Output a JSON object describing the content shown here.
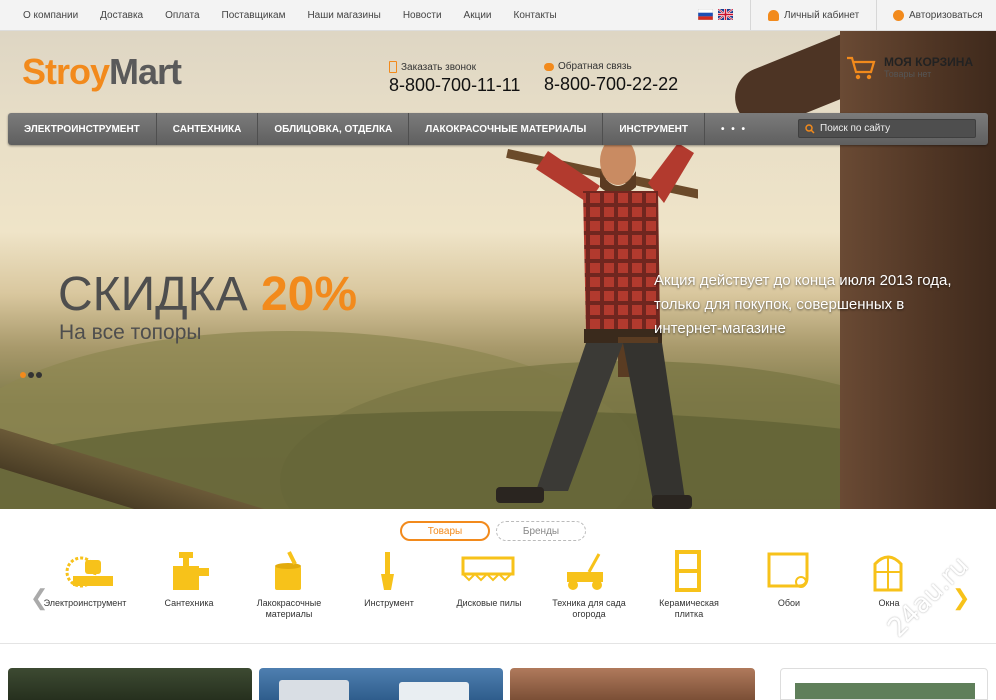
{
  "topnav": [
    "О компании",
    "Доставка",
    "Оплата",
    "Поставщикам",
    "Наши магазины",
    "Новости",
    "Акции",
    "Контакты"
  ],
  "account": {
    "cabinet": "Личный кабинет",
    "login": "Авторизоваться"
  },
  "logo": {
    "part1": "Stroy",
    "part2": "Mart"
  },
  "phones": [
    {
      "label": "Заказать звонок",
      "number": "8-800-700-11-11",
      "icon": "phone-icon"
    },
    {
      "label": "Обратная связь",
      "number": "8-800-700-22-22",
      "icon": "chat-icon"
    }
  ],
  "cart": {
    "title": "МОЯ КОРЗИНА",
    "subtitle": "Товары нет"
  },
  "menu": [
    "ЭЛЕКТРОИНСТРУМЕНТ",
    "САНТЕХНИКА",
    "ОБЛИЦОВКА, ОТДЕЛКА",
    "ЛАКОКРАСОЧНЫЕ МАТЕРИАЛЫ",
    "ИНСТРУМЕНТ",
    "• • •"
  ],
  "search": {
    "placeholder": "Поиск по сайту"
  },
  "promo": {
    "title": "СКИДКА",
    "percent": "20%",
    "subtitle": "На все топоры",
    "note": "Акция действует до конца июля 2013 года, только для покупок, совершенных в интернет-магазине"
  },
  "slider": {
    "active": 1,
    "count": 3
  },
  "tabs": [
    {
      "label": "Товары",
      "active": true
    },
    {
      "label": "Бренды",
      "active": false
    }
  ],
  "categories": [
    {
      "label": "Электроинструмент",
      "icon": "circular-saw-icon"
    },
    {
      "label": "Сантехника",
      "icon": "faucet-icon"
    },
    {
      "label": "Лакокрасочные материалы",
      "icon": "paint-can-icon"
    },
    {
      "label": "Инструмент",
      "icon": "screwdriver-icon"
    },
    {
      "label": "Дисковые пилы",
      "icon": "saw-blade-icon"
    },
    {
      "label": "Техника для сада огорода",
      "icon": "lawn-mower-icon"
    },
    {
      "label": "Керамическая плитка",
      "icon": "tile-icon"
    },
    {
      "label": "Обои",
      "icon": "wallpaper-roll-icon"
    },
    {
      "label": "Окна",
      "icon": "window-icon"
    }
  ],
  "watermark": "24au.ru",
  "colors": {
    "accent": "#f28a1c",
    "icon_yellow": "#f7c21a",
    "menu": "#6c6c6c"
  }
}
